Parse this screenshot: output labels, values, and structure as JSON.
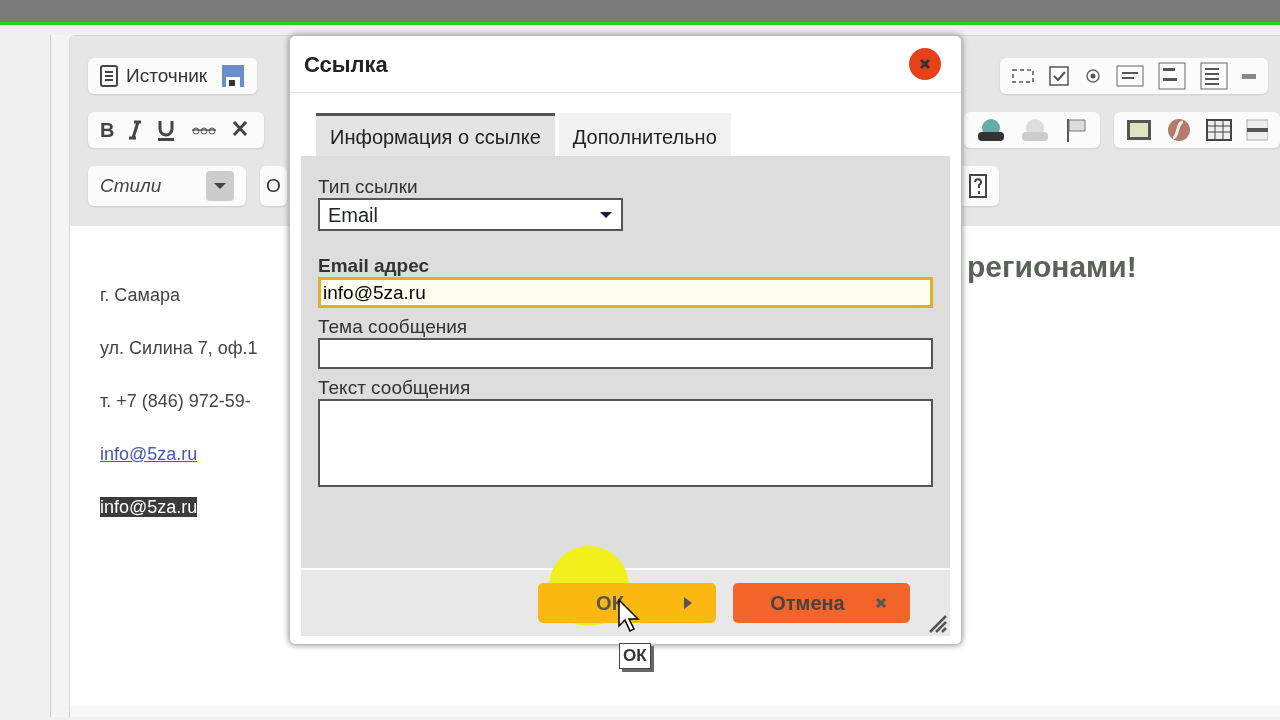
{
  "editor": {
    "toolbar": {
      "source_label": "Источник",
      "bold_label": "B",
      "styles_label": "Стили",
      "format_label": "О"
    },
    "heading": "регионами!",
    "content": [
      {
        "kind": "text",
        "text": "г. Самара"
      },
      {
        "kind": "text",
        "text": "ул. Силина 7, оф.1"
      },
      {
        "kind": "text",
        "text": "т. +7 (846) 972-59-"
      },
      {
        "kind": "link",
        "text": "info@5za.ru"
      },
      {
        "kind": "selected",
        "text": "info@5za.ru"
      }
    ]
  },
  "dialog": {
    "title": "Ссылка",
    "tabs": [
      {
        "label": "Информация о ссылке",
        "selected": true
      },
      {
        "label": "Дополнительно",
        "selected": false
      }
    ],
    "fields": [
      {
        "kind": "select",
        "label": "Тип ссылки",
        "value": "Email",
        "required": false,
        "focused": false
      },
      {
        "kind": "input",
        "label": "Email адрес",
        "value": "info@5za.ru",
        "required": true,
        "focused": true
      },
      {
        "kind": "input",
        "label": "Тема сообщения",
        "required": false,
        "focused": false
      },
      {
        "kind": "textarea",
        "label": "Текст сообщения",
        "required": false,
        "focused": false
      }
    ],
    "buttons": [
      {
        "kind": "ok",
        "label": "ОК"
      },
      {
        "kind": "cancel",
        "label": "Отмена"
      }
    ]
  },
  "tooltip": "ОК"
}
